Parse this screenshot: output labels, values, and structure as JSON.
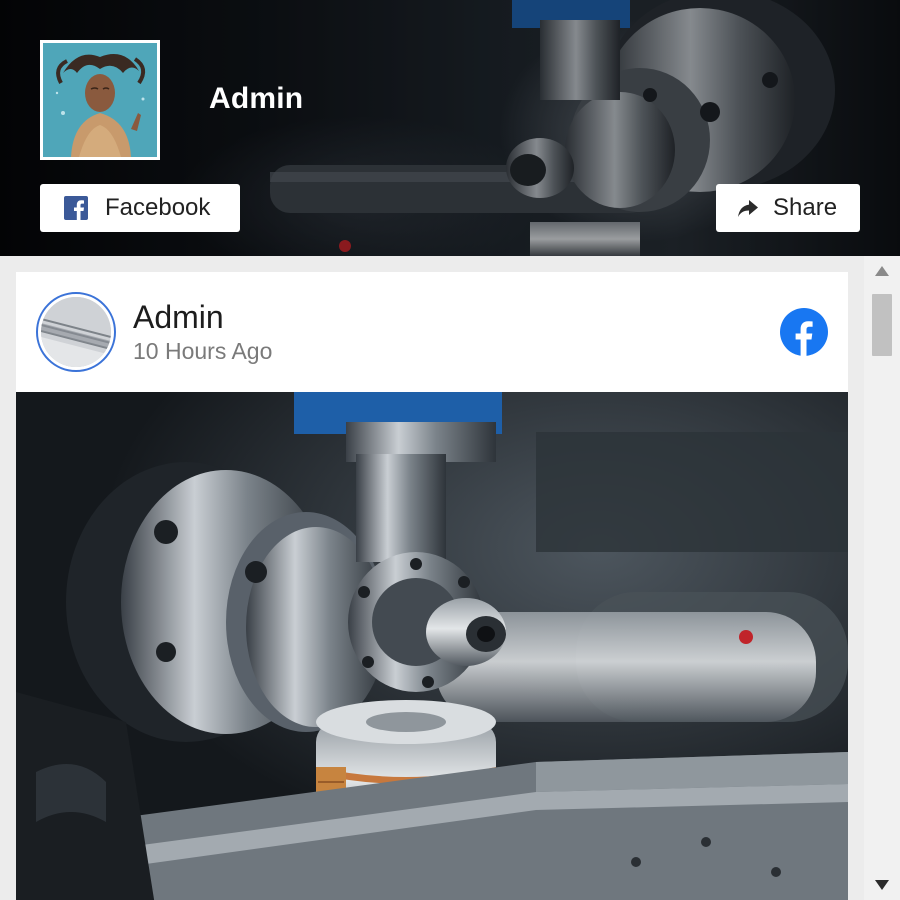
{
  "header": {
    "name": "Admin",
    "facebook_label": "Facebook",
    "share_label": "Share"
  },
  "post": {
    "author": "Admin",
    "time": "10 Hours Ago"
  },
  "colors": {
    "facebook_blue": "#1877f2",
    "avatar_ring": "#3b73d8",
    "lathe_blue": "#1e5fa8",
    "feed_background": "#ececec"
  },
  "icons": {
    "facebook_button": "facebook-square-icon",
    "share_button": "share-arrow-icon",
    "post_badge": "facebook-circle-icon",
    "scroll_up": "triangle-up-icon",
    "scroll_down": "triangle-down-icon"
  }
}
